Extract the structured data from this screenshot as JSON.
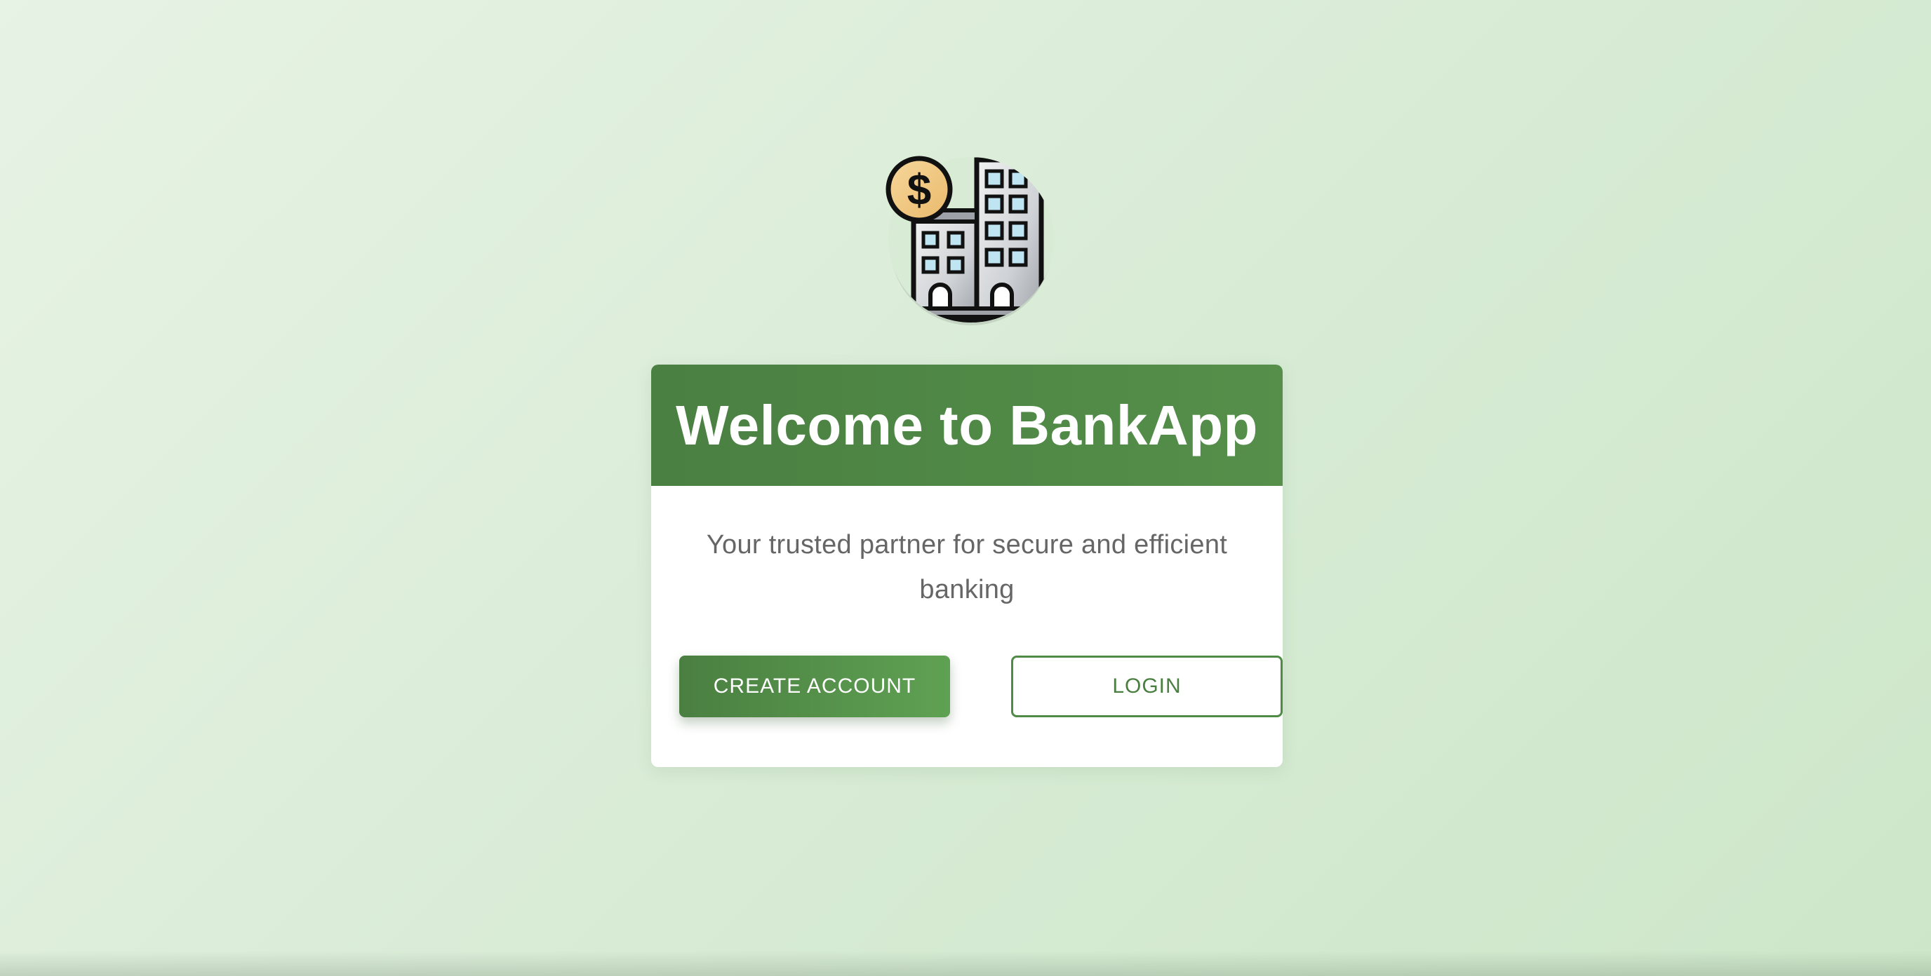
{
  "app": {
    "logo_icon": "bank-building-dollar-icon",
    "title": "Welcome to BankApp",
    "tagline": "Your trusted partner for secure and efficient banking"
  },
  "actions": {
    "create_account_label": "CREATE ACCOUNT",
    "login_label": "LOGIN"
  },
  "colors": {
    "brand_green": "#4a8042",
    "brand_green_light": "#5fa153",
    "background": "#d9ecd6",
    "tagline_text": "#666666"
  }
}
